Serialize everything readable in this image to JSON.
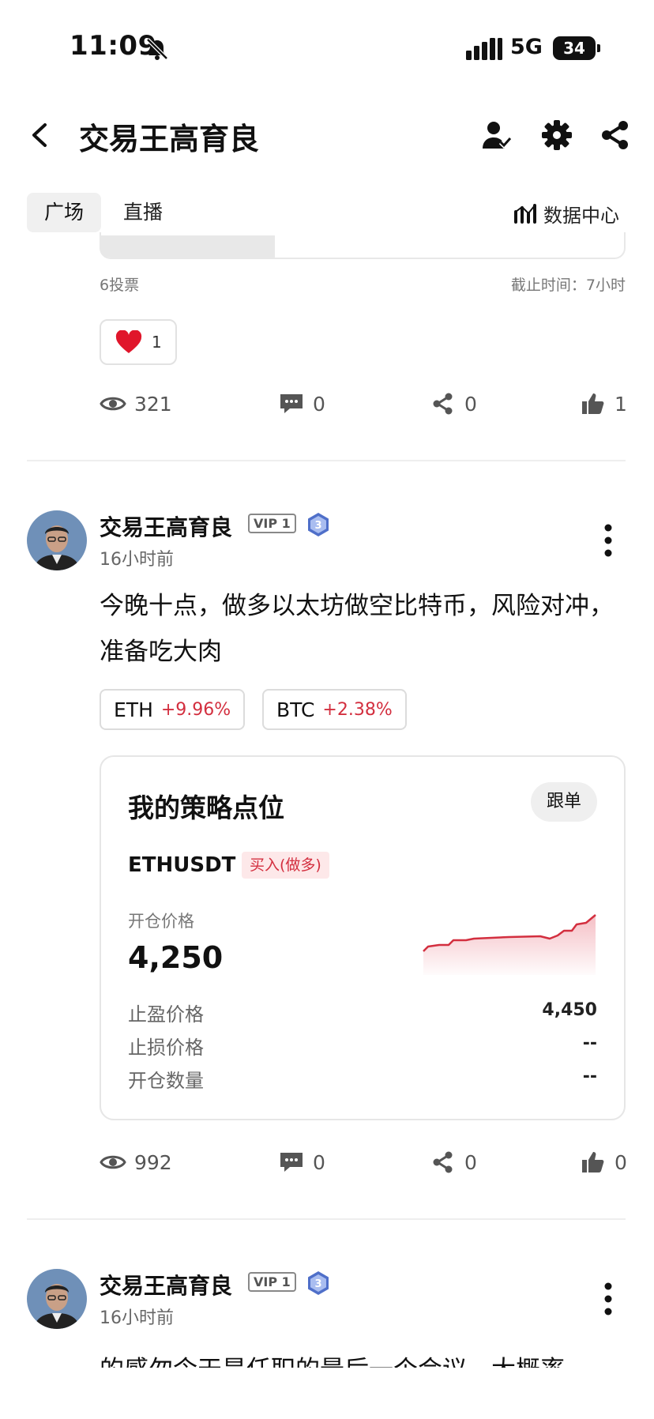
{
  "status_bar": {
    "time": "11:09",
    "network": "5G",
    "battery": "34"
  },
  "header": {
    "title": "交易王高育良"
  },
  "tabs": [
    "广场",
    "直播"
  ],
  "data_center_label": "数据中心",
  "poll": {
    "votes": "6投票",
    "deadline": "截止时间：7小时"
  },
  "like_reaction": {
    "count": "1"
  },
  "post0_stats": {
    "views": "321",
    "comments": "0",
    "shares": "0",
    "likes": "1"
  },
  "post1": {
    "author": "交易王高育良",
    "vip": "VIP 1",
    "level": "3",
    "time": "16小时前",
    "text": "今晚十点，做多以太坊做空比特币，风险对冲，准备吃大肉",
    "tickers": [
      {
        "symbol": "ETH",
        "change": "+9.96%"
      },
      {
        "symbol": "BTC",
        "change": "+2.38%"
      }
    ],
    "strategy": {
      "title": "我的策略点位",
      "follow": "跟单",
      "pair": "ETHUSDT",
      "side": "买入(做多)",
      "open_price_label": "开仓价格",
      "open_price": "4,250",
      "take_profit_label": "止盈价格",
      "take_profit": "4,450",
      "stop_loss_label": "止损价格",
      "stop_loss": "--",
      "quantity_label": "开仓数量",
      "quantity": "--",
      "accent_color": "#d32f3f"
    },
    "stats": {
      "views": "992",
      "comments": "0",
      "shares": "0",
      "likes": "0"
    }
  },
  "post2": {
    "author": "交易王高育良",
    "vip": "VIP 1",
    "level": "3",
    "time": "16小时前",
    "text_partial": "的感勿令天是任职的最后一个会议，大概率"
  }
}
